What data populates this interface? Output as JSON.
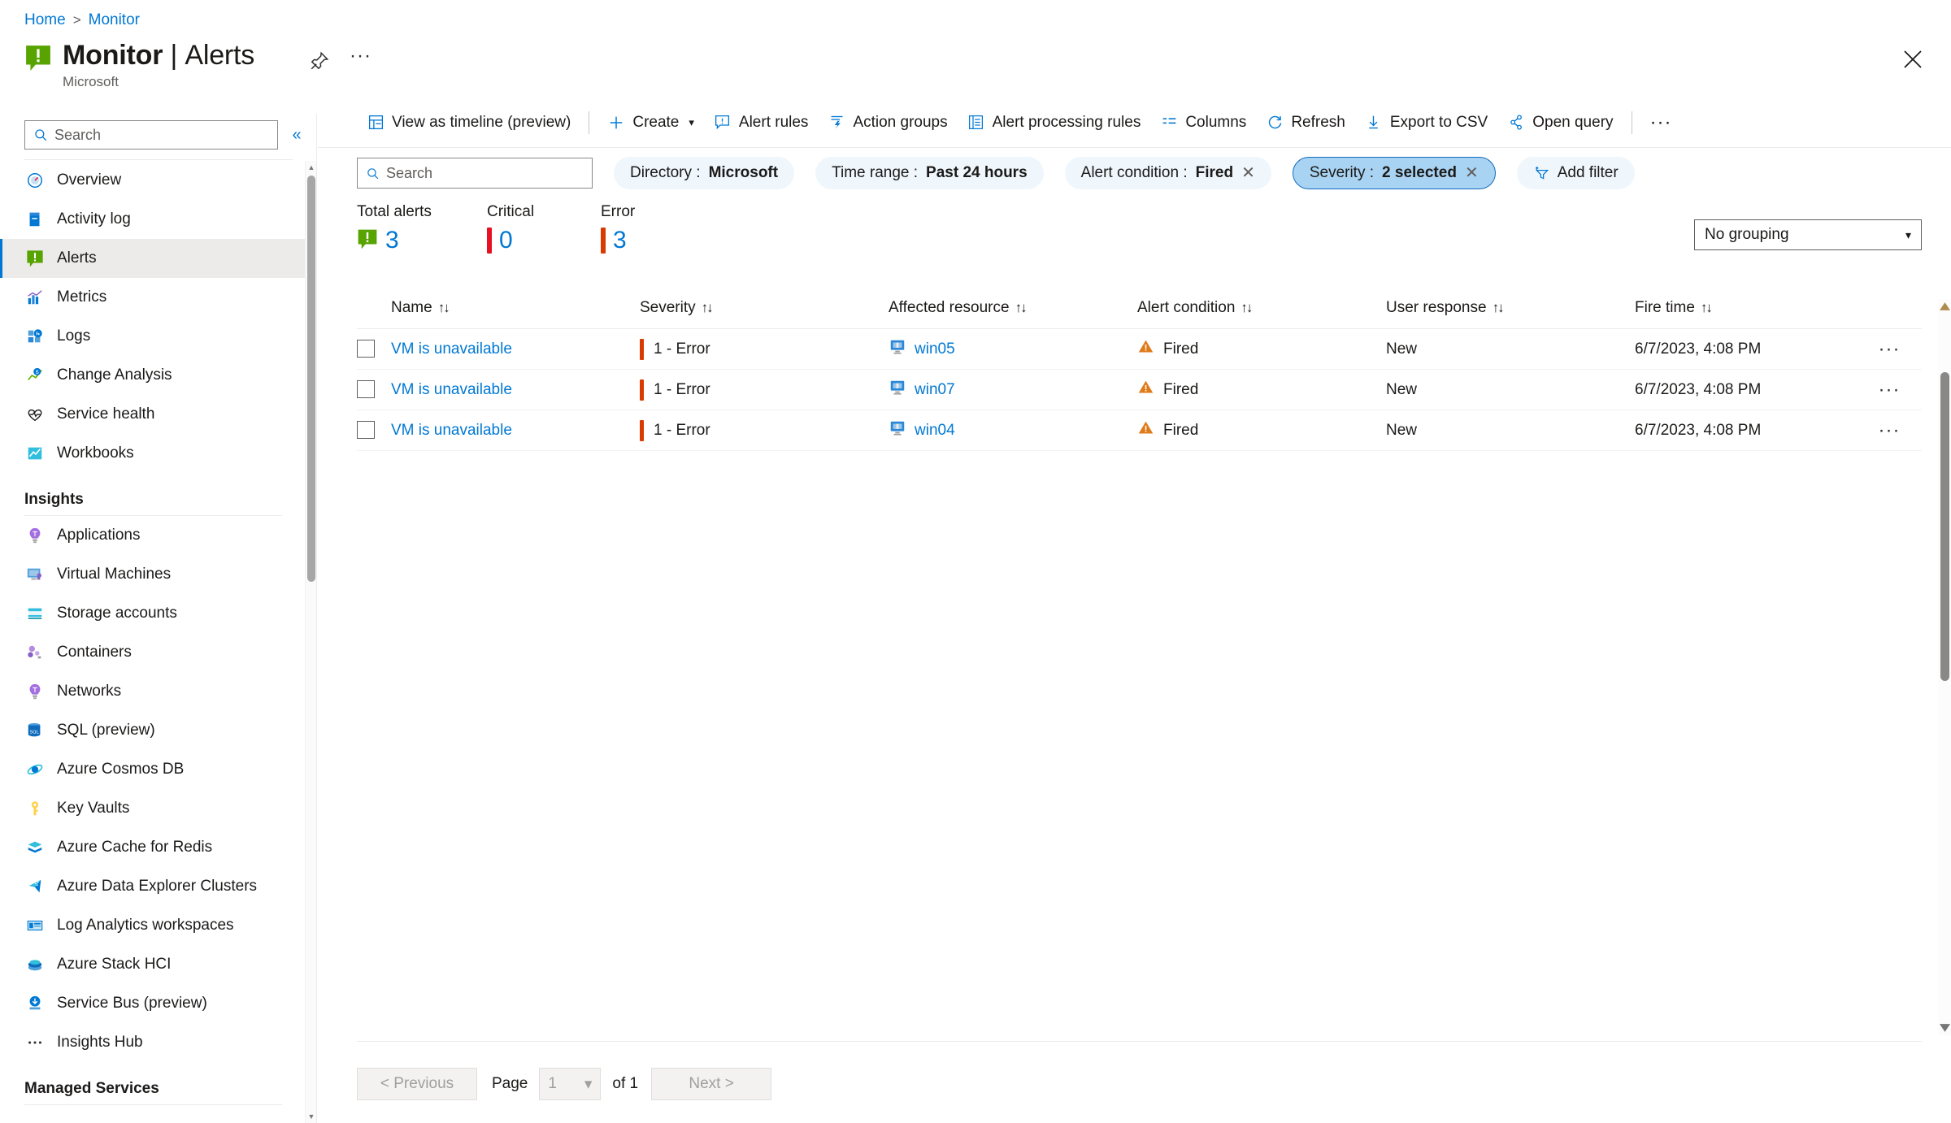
{
  "breadcrumb": {
    "home": "Home",
    "separator": ">",
    "current": "Monitor"
  },
  "header": {
    "title_main": "Monitor",
    "title_divider": "|",
    "title_sub": "Alerts",
    "subtitle": "Microsoft",
    "pin_icon": "pin-icon",
    "more_label": "···",
    "close_icon": "close-icon"
  },
  "sidebar": {
    "search_placeholder": "Search",
    "collapse_icon": "«",
    "items": [
      {
        "label": "Overview",
        "icon": "overview-icon",
        "active": false
      },
      {
        "label": "Activity log",
        "icon": "activity-log-icon",
        "active": false
      },
      {
        "label": "Alerts",
        "icon": "alerts-icon",
        "active": true
      },
      {
        "label": "Metrics",
        "icon": "metrics-icon",
        "active": false
      },
      {
        "label": "Logs",
        "icon": "logs-icon",
        "active": false
      },
      {
        "label": "Change Analysis",
        "icon": "change-analysis-icon",
        "active": false
      },
      {
        "label": "Service health",
        "icon": "service-health-icon",
        "active": false
      },
      {
        "label": "Workbooks",
        "icon": "workbooks-icon",
        "active": false
      }
    ],
    "insights_section": "Insights",
    "insights_items": [
      {
        "label": "Applications",
        "icon": "applications-icon"
      },
      {
        "label": "Virtual Machines",
        "icon": "virtual-machines-icon"
      },
      {
        "label": "Storage accounts",
        "icon": "storage-accounts-icon"
      },
      {
        "label": "Containers",
        "icon": "containers-icon"
      },
      {
        "label": "Networks",
        "icon": "networks-icon"
      },
      {
        "label": "SQL (preview)",
        "icon": "sql-icon"
      },
      {
        "label": "Azure Cosmos DB",
        "icon": "cosmos-db-icon"
      },
      {
        "label": "Key Vaults",
        "icon": "key-vaults-icon"
      },
      {
        "label": "Azure Cache for Redis",
        "icon": "redis-icon"
      },
      {
        "label": "Azure Data Explorer Clusters",
        "icon": "data-explorer-icon"
      },
      {
        "label": "Log Analytics workspaces",
        "icon": "log-analytics-icon"
      },
      {
        "label": "Azure Stack HCI",
        "icon": "stack-hci-icon"
      },
      {
        "label": "Service Bus (preview)",
        "icon": "service-bus-icon"
      },
      {
        "label": "Insights Hub",
        "icon": "ellipsis-icon"
      }
    ],
    "managed_services_section": "Managed Services"
  },
  "toolbar": {
    "view_timeline": "View as timeline (preview)",
    "create": "Create",
    "alert_rules": "Alert rules",
    "action_groups": "Action groups",
    "alert_processing_rules": "Alert processing rules",
    "columns": "Columns",
    "refresh": "Refresh",
    "export_csv": "Export to CSV",
    "open_query": "Open query",
    "more": "···"
  },
  "filters": {
    "search_placeholder": "Search",
    "chips": [
      {
        "label": "Directory :",
        "value": "Microsoft",
        "removable": false,
        "selected": false
      },
      {
        "label": "Time range :",
        "value": "Past 24 hours",
        "removable": false,
        "selected": false
      },
      {
        "label": "Alert condition :",
        "value": "Fired",
        "removable": true,
        "selected": false
      },
      {
        "label": "Severity :",
        "value": "2 selected",
        "removable": true,
        "selected": true
      }
    ],
    "add_filter": "Add filter"
  },
  "summary": {
    "counters": [
      {
        "label": "Total alerts",
        "value": "3",
        "color": "#57a300",
        "kind": "icon"
      },
      {
        "label": "Critical",
        "value": "0",
        "color": "#e81123",
        "kind": "bar"
      },
      {
        "label": "Error",
        "value": "3",
        "color": "#d83b01",
        "kind": "bar"
      }
    ]
  },
  "grouping": {
    "value": "No grouping",
    "caret": "⌵"
  },
  "table": {
    "sort_glyph": "↑↓",
    "columns": [
      "Name",
      "Severity",
      "Affected resource",
      "Alert condition",
      "User response",
      "Fire time"
    ],
    "rows": [
      {
        "name": "VM is unavailable",
        "severity": "1 - Error",
        "resource": "win05",
        "condition": "Fired",
        "user_response": "New",
        "fire_time": "6/7/2023, 4:08 PM",
        "menu": "···"
      },
      {
        "name": "VM is unavailable",
        "severity": "1 - Error",
        "resource": "win07",
        "condition": "Fired",
        "user_response": "New",
        "fire_time": "6/7/2023, 4:08 PM",
        "menu": "···"
      },
      {
        "name": "VM is unavailable",
        "severity": "1 - Error",
        "resource": "win04",
        "condition": "Fired",
        "user_response": "New",
        "fire_time": "6/7/2023, 4:08 PM",
        "menu": "···"
      }
    ]
  },
  "pager": {
    "previous": "< Previous",
    "page_label": "Page",
    "page_value": "1",
    "of_label": "of 1",
    "next": "Next >"
  },
  "colors": {
    "accent": "#0078d4",
    "error": "#d83b01",
    "critical": "#e81123",
    "alert_green": "#57a300",
    "chip_bg": "#eff6fc",
    "chip_selected_bg": "#a9d3f2"
  }
}
